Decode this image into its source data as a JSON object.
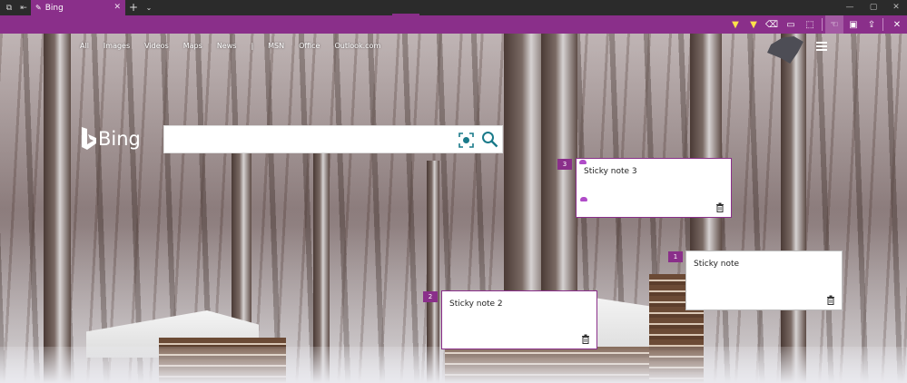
{
  "browser": {
    "tab_title": "Bing",
    "new_tab_symbol": "+",
    "tab_menu_symbol": "⌄",
    "close_tab_symbol": "✕",
    "window_controls": [
      "—",
      "▢",
      "✕"
    ]
  },
  "ink_toolbar": {
    "accent": "#8a2f8a",
    "tools": [
      "ballpoint-pen",
      "highlighter",
      "eraser",
      "add-note",
      "clip"
    ],
    "actions": [
      "touch-writing",
      "save",
      "share",
      "exit"
    ]
  },
  "bing": {
    "nav": [
      "All",
      "Images",
      "Videos",
      "Maps",
      "News",
      "|",
      "MSN",
      "Office",
      "Outlook.com"
    ],
    "logo_text": "Bing",
    "search_value": ""
  },
  "notes": [
    {
      "number": "3",
      "text": "Sticky note 3"
    },
    {
      "number": "1",
      "text": "Sticky note"
    },
    {
      "number": "2",
      "text": "Sticky note 2"
    }
  ]
}
